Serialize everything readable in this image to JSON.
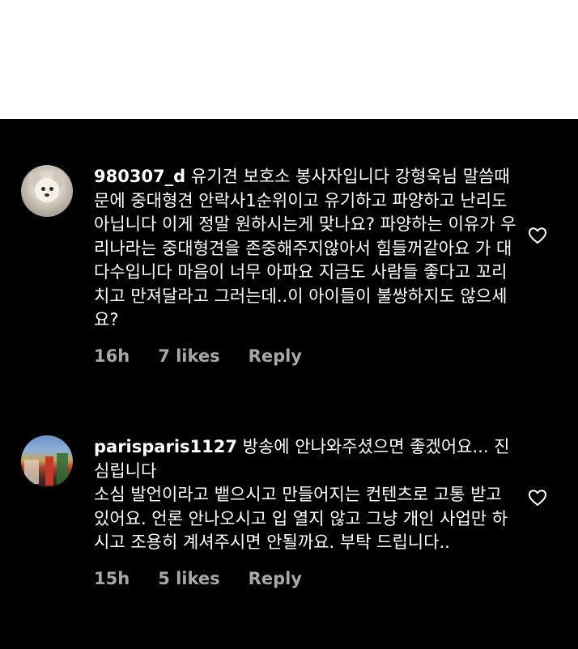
{
  "comments": [
    {
      "username": "980307_d",
      "text": "유기견 보호소 봉사자입니다 강형욱님 말씀때문에 중대형견 안락사1순위이고 유기하고 파양하고 난리도 아닙니다 이게 정말 원하시는게 맞나요? 파양하는 이유가 우리나라는 중대형견을 존중해주지않아서 힘들꺼같아요 가 대다수입니다 마음이 너무 아파요 지금도 사람들 좋다고 꼬리치고 만져달라고 그러는데..이 아이들이 불쌍하지도 않으세요?",
      "time": "16h",
      "likes": "7 likes",
      "reply": "Reply",
      "avatar_icon": "dog-avatar",
      "like_icon": "heart-outline-icon"
    },
    {
      "username": "parisparis1127",
      "text": "방송에 안나와주셨으면 좋겠어요... 진심립니다\n소심 발언이라고 뱉으시고 만들어지는 컨텐츠로 고통 받고 있어요. 언론 안나오시고 입 열지 않고 그냥 개인 사업만 하시고 조용히 계셔주시면 안될까요. 부탁 드립니다..",
      "time": "15h",
      "likes": "5 likes",
      "reply": "Reply",
      "avatar_icon": "street-photo-avatar",
      "like_icon": "heart-outline-icon"
    }
  ],
  "colors": {
    "panel_bg": "#000000",
    "text": "#ffffff",
    "meta": "#a8a8a8",
    "page_bg": "#ffffff"
  }
}
